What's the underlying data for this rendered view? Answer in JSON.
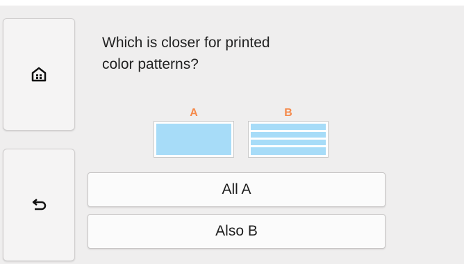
{
  "question": {
    "line1": "Which is closer for printed",
    "line2": "color patterns?"
  },
  "patterns": {
    "a_label": "A",
    "b_label": "B"
  },
  "choices": {
    "all_a": "All A",
    "also_b": "Also B"
  },
  "sidebar": {
    "home_icon": "home-icon",
    "back_icon": "back-arrow-icon"
  },
  "colors": {
    "label_accent": "#f58a4b",
    "pattern_fill": "#a7dcf8"
  }
}
